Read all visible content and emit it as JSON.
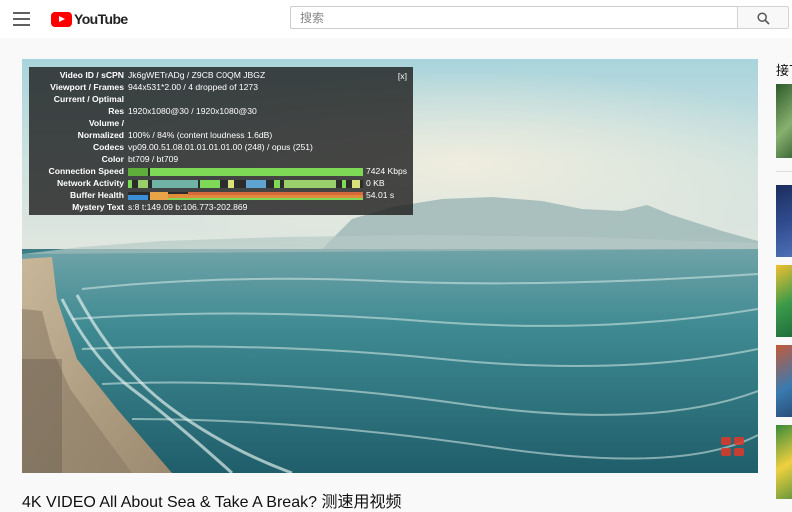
{
  "header": {
    "logo_text": "YouTube",
    "search_placeholder": "搜索"
  },
  "stats": {
    "close_label": "[x]",
    "rows": [
      {
        "label": "Video ID / sCPN",
        "value": "Jk6gWETrADg / Z9CB C0QM JBGZ"
      },
      {
        "label": "Viewport / Frames",
        "value": "944x531*2.00 / 4 dropped of 1273"
      },
      {
        "label": "Current / Optimal",
        "value": ""
      },
      {
        "label": "Res",
        "value": "1920x1080@30 / 1920x1080@30"
      },
      {
        "label": "Volume /",
        "value": ""
      },
      {
        "label": "Normalized",
        "value": "100% / 84% (content loudness 1.6dB)"
      },
      {
        "label": "Codecs",
        "value": "vp09.00.51.08.01.01.01.01.00 (248) / opus (251)"
      },
      {
        "label": "Color",
        "value": "bt709 / bt709"
      }
    ],
    "graphs": [
      {
        "label": "Connection Speed",
        "value": "7424 Kbps"
      },
      {
        "label": "Network Activity",
        "value": "0 KB"
      },
      {
        "label": "Buffer Health",
        "value": "54.01 s"
      }
    ],
    "mystery": {
      "label": "Mystery Text",
      "value": "s:8 t:149.09 b:106.773-202.869"
    }
  },
  "video": {
    "title": "4K VIDEO All About Sea & Take A Break?  测速用视频"
  },
  "sidebar": {
    "up_next_label": "接下"
  },
  "colors": {
    "brand": "#ff0000",
    "graph_green": "#7ed957",
    "graph_blue": "#3a8fd8",
    "graph_orange": "#e8a447"
  },
  "icons": [
    "menu-icon",
    "youtube-logo-icon",
    "search-icon",
    "close-icon"
  ]
}
